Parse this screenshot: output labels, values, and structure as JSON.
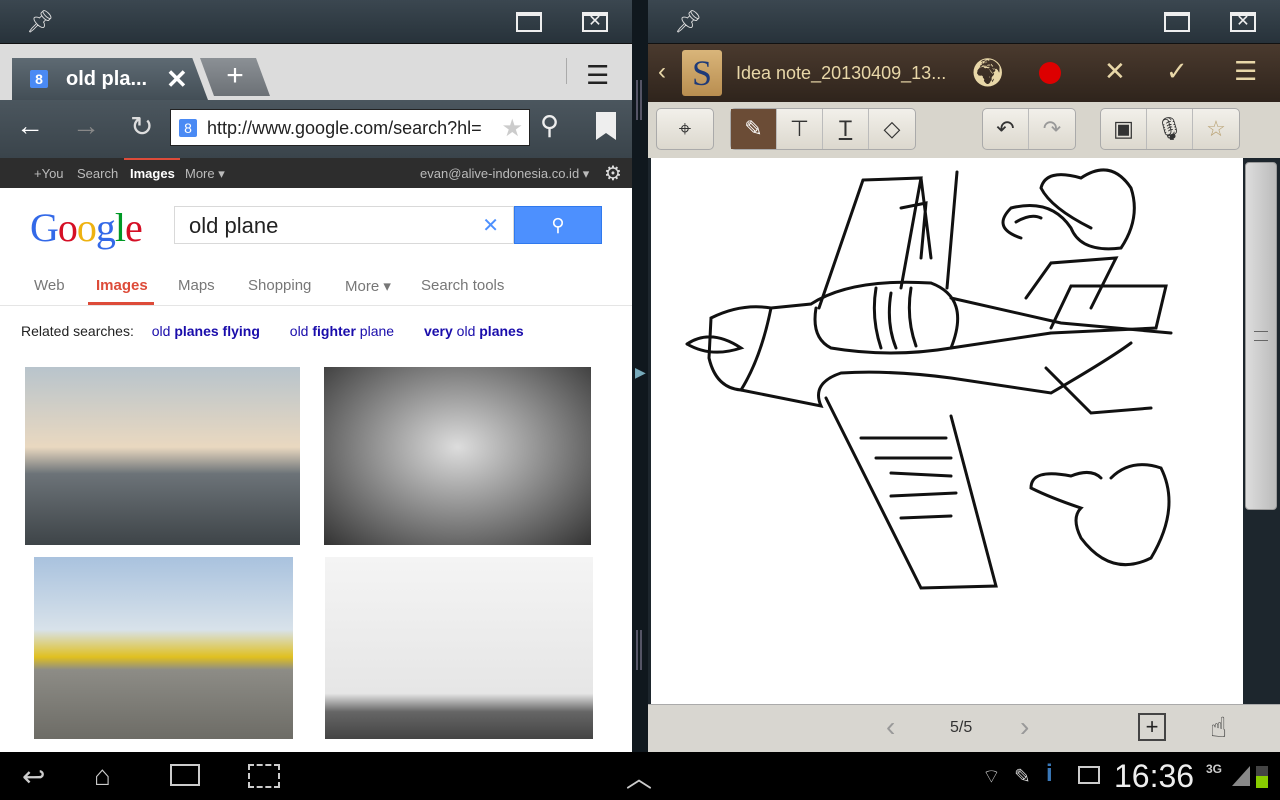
{
  "left_window": {
    "pin_icon": "pin-icon",
    "maximize_icon": "maximize-icon",
    "close_icon": "close-icon"
  },
  "browser": {
    "tab": {
      "title": "old pla...",
      "close": "✕"
    },
    "new_tab": "+",
    "url": "http://www.google.com/search?hl=",
    "google_bar": {
      "you": "+You",
      "search": "Search",
      "images": "Images",
      "more": "More ▾",
      "account": "evan@alive-indonesia.co.id ▾"
    },
    "logo": "Google",
    "query": "old plane",
    "clear": "✕",
    "tabs": [
      "Web",
      "Images",
      "Maps",
      "Shopping",
      "More ▾",
      "Search tools"
    ],
    "related_label": "Related searches:",
    "related": [
      {
        "pre": "old ",
        "bold": "planes flying"
      },
      {
        "pre": "old ",
        "bold": "fighter",
        "post": " plane"
      },
      {
        "pre": "",
        "bold": "very",
        "post": " old ",
        "bold2": "planes"
      }
    ],
    "accent": "#dd4b39"
  },
  "snote": {
    "title": "Idea note_20130409_13...",
    "page": "5/5",
    "tools": [
      "select",
      "pen",
      "text-box",
      "text",
      "eraser",
      "undo",
      "redo",
      "insert-image",
      "voice",
      "favorite"
    ]
  },
  "status": {
    "time": "16:36",
    "network": "3G"
  }
}
